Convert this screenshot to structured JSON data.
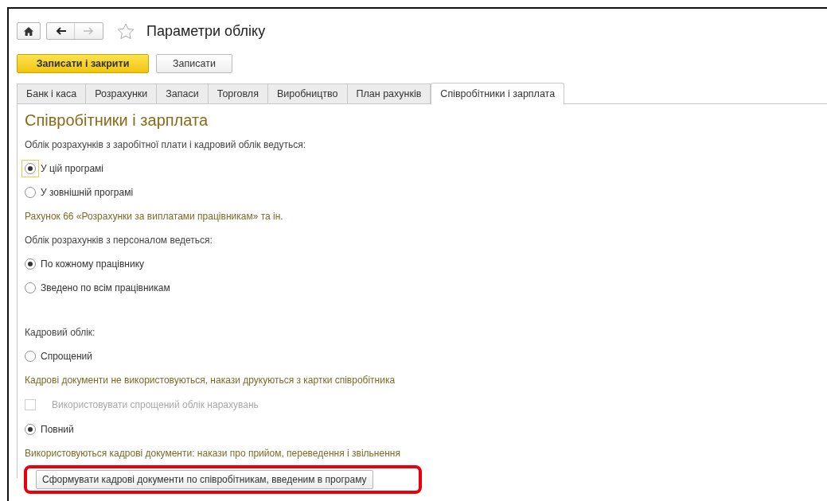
{
  "window": {
    "title": "Параметри обліку",
    "favorite": false
  },
  "nav": {
    "back_enabled": true,
    "forward_enabled": false
  },
  "buttons": [
    {
      "label": "Записати і закрити",
      "kind": "primary"
    },
    {
      "label": "Записати",
      "kind": "default"
    }
  ],
  "tabs": [
    {
      "label": "Банк і каса",
      "selected": false
    },
    {
      "label": "Розрахунки",
      "selected": false
    },
    {
      "label": "Запаси",
      "selected": false
    },
    {
      "label": "Торговля",
      "selected": false
    },
    {
      "label": "Виробництво",
      "selected": false
    },
    {
      "label": "План рахунків",
      "selected": false
    },
    {
      "label": "Співробітники і зарплата",
      "selected": true
    }
  ],
  "section": {
    "heading": "Співробітники і зарплата",
    "items": [
      {
        "kind": "label",
        "text": "Облік розрахунків з заробітної плати і кадровий облік ведуться:"
      },
      {
        "kind": "radio",
        "text": "У цій програмі",
        "selected": true,
        "focused": true
      },
      {
        "kind": "radio",
        "text": "У зовнішній програмі",
        "selected": false,
        "focused": false
      },
      {
        "kind": "hint",
        "text": "Рахунок 66 «Розрахунки за виплатами працівникам» та ін."
      },
      {
        "kind": "label",
        "text": "Облік розрахунків з персоналом ведеться:"
      },
      {
        "kind": "radio",
        "text": "По кожному працівнику",
        "selected": true,
        "focused": false
      },
      {
        "kind": "radio",
        "text": "Зведено по всім працівникам",
        "selected": false,
        "focused": false
      },
      {
        "kind": "spacer"
      },
      {
        "kind": "label",
        "text": "Кадровий облік:"
      },
      {
        "kind": "radio",
        "text": "Спрощений",
        "selected": false,
        "focused": false
      },
      {
        "kind": "hint",
        "text": "Кадрові документи не використовуються, накази друкуються з картки співробітника"
      },
      {
        "kind": "checkbox",
        "text": "Використовувати спрощений облік нарахувань",
        "checked": false,
        "disabled": true
      },
      {
        "kind": "radio",
        "text": "Повний",
        "selected": true,
        "focused": false
      },
      {
        "kind": "hint",
        "text": "Використовуються кадрові документи: накази про прийом, переведення і звільнення"
      },
      {
        "kind": "button",
        "text": "Сформувати кадрові документи по співробітникам, введеним в програму",
        "highlighted": true
      }
    ]
  }
}
